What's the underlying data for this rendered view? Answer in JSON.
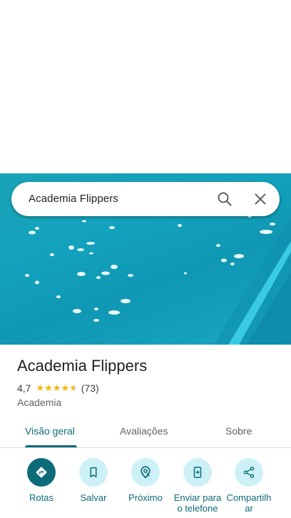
{
  "search": {
    "query": "Academia Flippers"
  },
  "place": {
    "title": "Academia Flippers",
    "rating": "4,7",
    "rating_value": 4.7,
    "review_count": "(73)",
    "category": "Academia"
  },
  "tabs": [
    {
      "label": "Visão geral",
      "active": true
    },
    {
      "label": "Avaliações",
      "active": false
    },
    {
      "label": "Sobre",
      "active": false
    }
  ],
  "actions": [
    {
      "label": "Rotas",
      "icon": "directions-icon",
      "primary": true
    },
    {
      "label": "Salvar",
      "icon": "bookmark-icon",
      "primary": false
    },
    {
      "label": "Próximo",
      "icon": "nearby-icon",
      "primary": false
    },
    {
      "label": "Enviar para o telefone",
      "icon": "send-to-phone-icon",
      "primary": false
    },
    {
      "label": "Compartilhar",
      "icon": "share-icon",
      "primary": false
    }
  ],
  "colors": {
    "accent": "#0b6b78",
    "action_bg": "#cdf1f7",
    "star": "#f6b400",
    "water": "#13a2bd"
  }
}
